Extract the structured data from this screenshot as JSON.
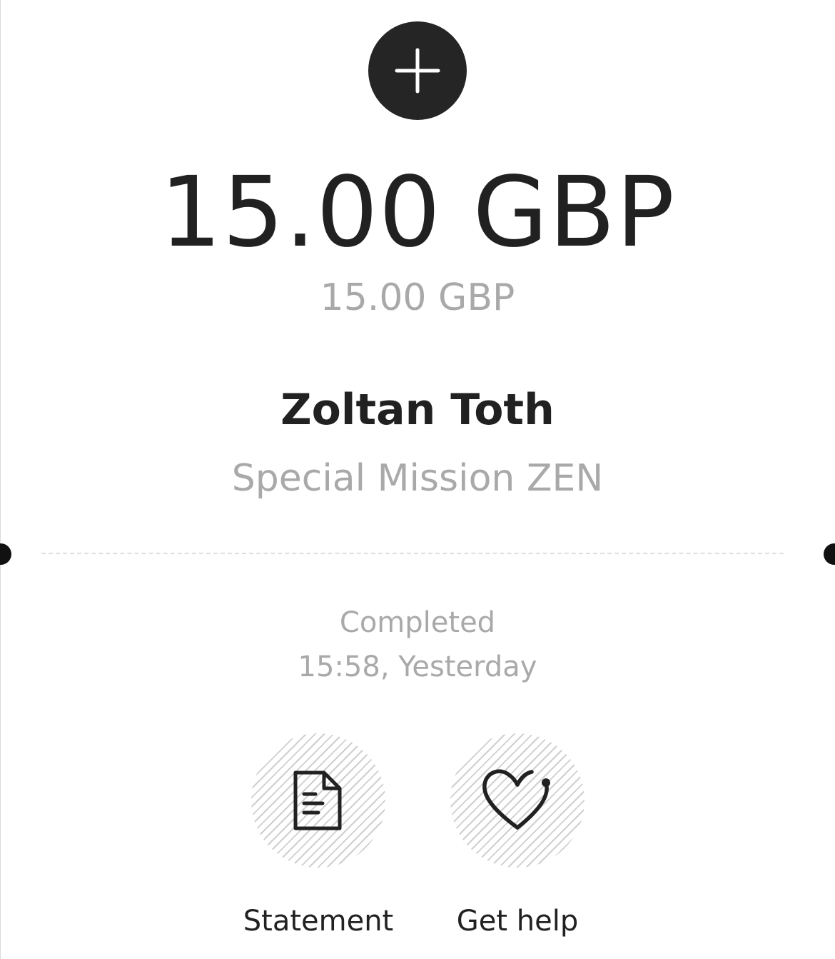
{
  "header": {
    "icon": "plus-icon"
  },
  "transaction": {
    "amount": "15.00 GBP",
    "amount_secondary": "15.00 GBP",
    "merchant_name": "Zoltan Toth",
    "description": "Special Mission ZEN",
    "status": "Completed",
    "datetime": "15:58, Yesterday"
  },
  "actions": [
    {
      "label": "Statement",
      "icon": "document-icon"
    },
    {
      "label": "Get help",
      "icon": "heart-icon"
    }
  ],
  "colors": {
    "primary_text": "#212121",
    "secondary_text": "#a9a9a9",
    "icon_background": "#252525",
    "divider": "#dedede"
  }
}
